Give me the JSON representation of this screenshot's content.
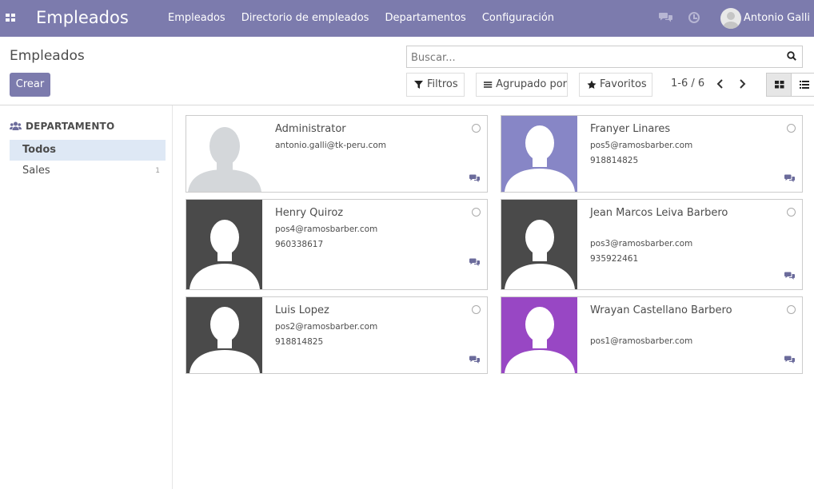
{
  "navbar": {
    "app_title": "Empleados",
    "menu": [
      "Empleados",
      "Directorio de empleados",
      "Departamentos",
      "Configuración"
    ],
    "user_name": "Antonio Galli",
    "bg_color": "#7c7bad"
  },
  "control_panel": {
    "title": "Empleados",
    "create_label": "Crear",
    "search_placeholder": "Buscar...",
    "filters_label": "Filtros",
    "group_by_label": "Agrupado por",
    "favorites_label": "Favoritos",
    "pager": "1-6 / 6"
  },
  "sidebar": {
    "header": "DEPARTAMENTO",
    "items": [
      {
        "label": "Todos",
        "count": ""
      },
      {
        "label": "Sales",
        "count": "1"
      }
    ]
  },
  "employees": [
    {
      "name": "Administrator",
      "email": "antonio.galli@tk-peru.com",
      "phone": "",
      "photo": "light"
    },
    {
      "name": "Franyer Linares",
      "email": "pos5@ramosbarber.com",
      "phone": "918814825",
      "photo": "#8786c6"
    },
    {
      "name": "Henry Quiroz",
      "email": "pos4@ramosbarber.com",
      "phone": "960338617",
      "photo": "#4a4a4a"
    },
    {
      "name": "Jean Marcos Leiva Barbero",
      "email": "pos3@ramosbarber.com",
      "phone": "935922461",
      "photo": "#4a4a4a"
    },
    {
      "name": "Luis Lopez",
      "email": "pos2@ramosbarber.com",
      "phone": "918814825",
      "photo": "#4a4a4a"
    },
    {
      "name": "Wrayan Castellano Barbero",
      "email": "pos1@ramosbarber.com",
      "phone": "",
      "photo": "#9847c4"
    }
  ]
}
